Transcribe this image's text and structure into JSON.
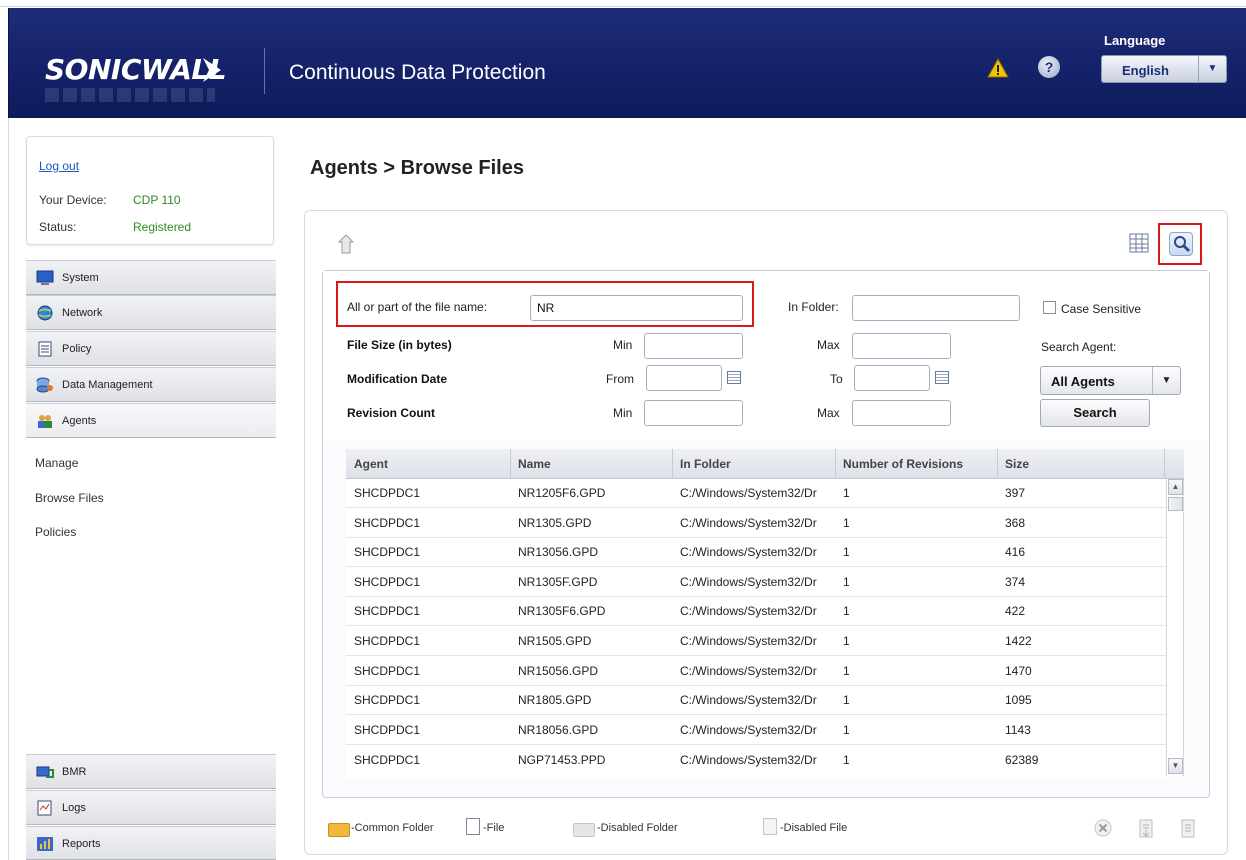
{
  "header": {
    "logo_text": "SONICWALL",
    "title": "Continuous Data Protection",
    "language_label": "Language",
    "language_value": "English",
    "help_glyph": "?"
  },
  "sidebar": {
    "logout": "Log out",
    "device_label": "Your Device:",
    "device_value": "CDP 110",
    "status_label": "Status:",
    "status_value": "Registered",
    "nav": [
      {
        "label": "System",
        "icon": "monitor-icon"
      },
      {
        "label": "Network",
        "icon": "globe-icon"
      },
      {
        "label": "Policy",
        "icon": "document-icon"
      },
      {
        "label": "Data Management",
        "icon": "database-icon"
      },
      {
        "label": "Agents",
        "icon": "users-icon"
      }
    ],
    "sub_items": [
      "Manage",
      "Browse Files",
      "Policies"
    ],
    "bottom_nav": [
      {
        "label": "BMR",
        "icon": "computer-icon"
      },
      {
        "label": "Logs",
        "icon": "log-icon"
      },
      {
        "label": "Reports",
        "icon": "report-icon"
      }
    ]
  },
  "main": {
    "page_title": "Agents > Browse Files",
    "form": {
      "filename_label": "All or part of the file name:",
      "filename_value": "NR",
      "in_folder_label": "In Folder:",
      "in_folder_value": "",
      "case_sensitive_label": "Case Sensitive",
      "file_size_label": "File Size (in bytes)",
      "mod_date_label": "Modification Date",
      "rev_count_label": "Revision Count",
      "min_label": "Min",
      "max_label": "Max",
      "from_label": "From",
      "to_label": "To",
      "search_agent_label": "Search Agent:",
      "agent_value": "All Agents",
      "search_button": "Search"
    },
    "table": {
      "columns": [
        "Agent",
        "Name",
        "In Folder",
        "Number of Revisions",
        "Size"
      ],
      "rows": [
        [
          "SHCDPDC1",
          "NR1205F6.GPD",
          "C:/Windows/System32/Dr",
          "1",
          "397"
        ],
        [
          "SHCDPDC1",
          "NR1305.GPD",
          "C:/Windows/System32/Dr",
          "1",
          "368"
        ],
        [
          "SHCDPDC1",
          "NR13056.GPD",
          "C:/Windows/System32/Dr",
          "1",
          "416"
        ],
        [
          "SHCDPDC1",
          "NR1305F.GPD",
          "C:/Windows/System32/Dr",
          "1",
          "374"
        ],
        [
          "SHCDPDC1",
          "NR1305F6.GPD",
          "C:/Windows/System32/Dr",
          "1",
          "422"
        ],
        [
          "SHCDPDC1",
          "NR1505.GPD",
          "C:/Windows/System32/Dr",
          "1",
          "1422"
        ],
        [
          "SHCDPDC1",
          "NR15056.GPD",
          "C:/Windows/System32/Dr",
          "1",
          "1470"
        ],
        [
          "SHCDPDC1",
          "NR1805.GPD",
          "C:/Windows/System32/Dr",
          "1",
          "1095"
        ],
        [
          "SHCDPDC1",
          "NR18056.GPD",
          "C:/Windows/System32/Dr",
          "1",
          "1143"
        ],
        [
          "SHCDPDC1",
          "NGP71453.PPD",
          "C:/Windows/System32/Dr",
          "1",
          "62389"
        ]
      ]
    },
    "legend": {
      "common_folder": "-Common Folder",
      "file": "-File",
      "disabled_folder": "-Disabled Folder",
      "disabled_file": "-Disabled File"
    }
  },
  "colors": {
    "header_bg": "#15226a",
    "accent_red": "#d81a1a",
    "status_green": "#2d8a22",
    "link_blue": "#1d55c0"
  }
}
